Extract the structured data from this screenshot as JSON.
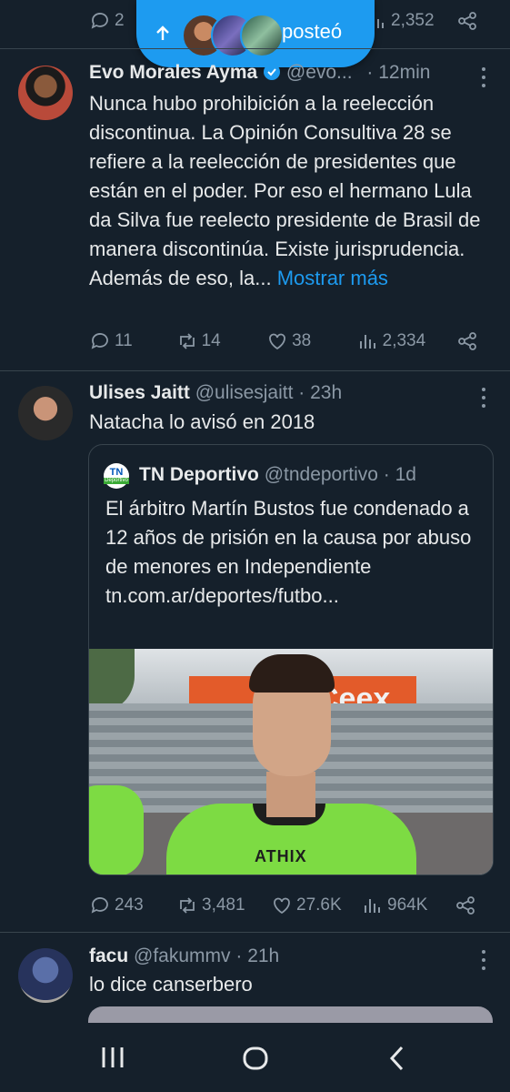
{
  "top_partial": {
    "reply_count": "2",
    "views": "2,352"
  },
  "new_posts_pill": {
    "label": "posteó",
    "color": "#1d9bf0"
  },
  "tweets": [
    {
      "name": "Evo Morales Ayma",
      "verified": true,
      "handle": "@evo...",
      "time": "· 12min",
      "text": "Nunca hubo prohibición a la reelección discontinua. La Opinión Consultiva 28 se refiere a la reelección de presidentes que están en el poder. Por eso el hermano Lula da Silva fue reelecto presidente de Brasil de manera discontinúa. Existe jurisprudencia. Además de eso, la...",
      "show_more": "Mostrar más",
      "replies": "11",
      "retweets": "14",
      "likes": "38",
      "views": "2,334"
    },
    {
      "name": "Ulises Jaitt",
      "handle": "@ulisesjaitt",
      "time": "· 23h",
      "text": "Natacha lo avisó en 2018",
      "quote": {
        "logo_text": "TN",
        "logo_sub": "Deportivo",
        "name": "TN Deportivo",
        "handle": "@tndeportivo",
        "time": "· 1d",
        "text": "El árbitro Martín Bustos fue condenado a 12 años de prisión en la causa por abuso de menores en Independiente tn.com.ar/deportes/futbo...",
        "image_shirt_text": "ATHIX",
        "image_wall_text": "Ceex"
      },
      "replies": "243",
      "retweets": "3,481",
      "likes": "27.6K",
      "views": "964K"
    },
    {
      "name": "facu",
      "handle": "@fakummv",
      "time": "· 21h",
      "text": "lo dice canserbero"
    }
  ],
  "colors": {
    "background": "#15202b",
    "accent": "#1d9bf0",
    "muted": "#8b98a5",
    "divider": "#38444d"
  },
  "nav_icons": [
    "recent-apps-icon",
    "home-icon",
    "back-icon"
  ]
}
